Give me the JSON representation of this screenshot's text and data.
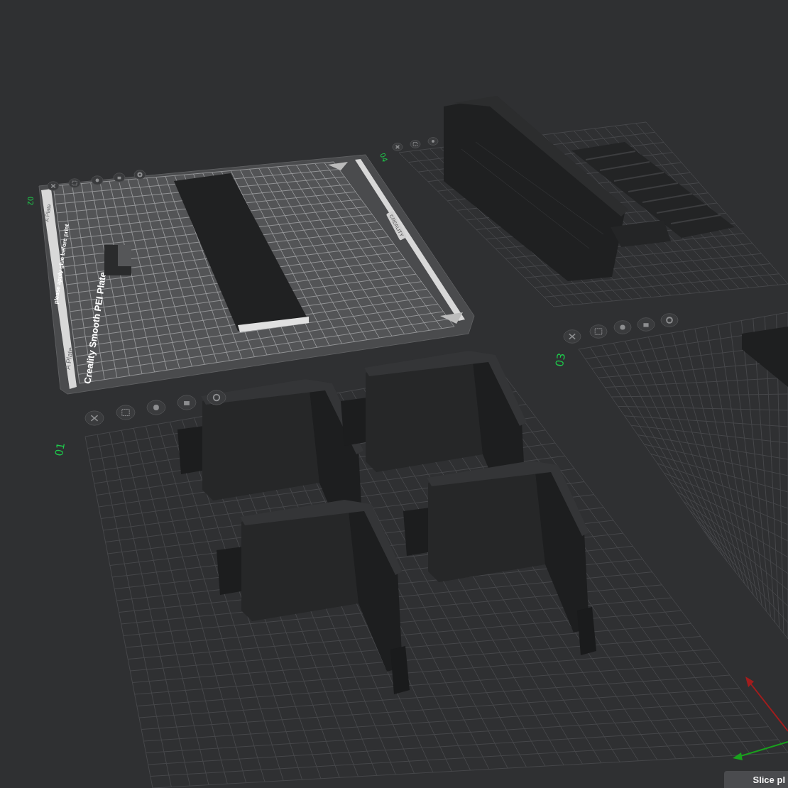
{
  "viewport": {
    "plates": [
      {
        "label": "02",
        "kind": "textured",
        "plate_name": "Creality Smooth PEI Plate",
        "notice": "please apply glue before print",
        "side_labels": [
          "A Plate",
          "A Plate"
        ],
        "brand": "CREALITY"
      },
      {
        "label": "04",
        "kind": "plain"
      },
      {
        "label": "03",
        "kind": "plain"
      },
      {
        "label": "01",
        "kind": "plain"
      }
    ]
  },
  "slice_button": {
    "label": "Slice pl"
  }
}
